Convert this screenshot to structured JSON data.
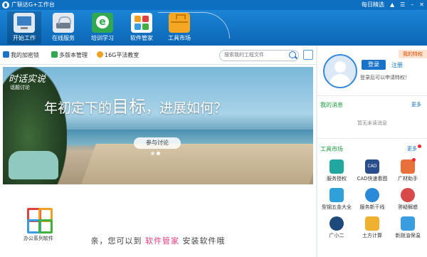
{
  "window": {
    "title": "广联达G+工作台",
    "daily_pick": "每日精选"
  },
  "nav": {
    "items": [
      {
        "label": "开始工作",
        "active": true
      },
      {
        "label": "在线服务",
        "active": false
      },
      {
        "label": "培训学习",
        "active": false
      },
      {
        "label": "软件管家",
        "active": false
      },
      {
        "label": "工具市场",
        "active": false
      }
    ]
  },
  "toolbar": {
    "encryption_lock": "我的加密锁",
    "multi_version": "多版本管理",
    "cloud_space": "16G平法教室",
    "search_placeholder": "搜索我的工程文件"
  },
  "banner": {
    "tag_line1": "时话实说",
    "tag_line2": "话题讨论",
    "headline_pre": "年初定下的",
    "headline_big": "目标",
    "headline_post": "，进展如何？",
    "join_button": "参与讨论"
  },
  "apps": {
    "office_suite": "办公系列软件"
  },
  "tip": {
    "pre": "亲，您可以到",
    "highlight": "软件管家",
    "post": "安装软件哦"
  },
  "sidebar": {
    "privilege_badge": "我的特权",
    "login_button": "登录",
    "register_link": "注册",
    "login_tip": "登录后可以申请特权！",
    "messages_title": "我的消息",
    "messages_more": "更多",
    "no_messages": "暂无未读消息",
    "tools_title": "工具市场",
    "tools_more": "更多",
    "tools": [
      {
        "label": "服务授权",
        "icon": "service-authorization-icon"
      },
      {
        "label": "CAD快速看图",
        "icon": "cad-viewer-icon"
      },
      {
        "label": "广材助手",
        "icon": "material-assistant-icon"
      },
      {
        "label": "型钢五金大全",
        "icon": "steel-hardware-icon"
      },
      {
        "label": "服务新干线",
        "icon": "service-line-icon"
      },
      {
        "label": "答疑解惑",
        "icon": "qa-icon"
      },
      {
        "label": "广小二",
        "icon": "assistant-bot-icon"
      },
      {
        "label": "土方计算",
        "icon": "earthwork-calc-icon"
      },
      {
        "label": "新刚油保温",
        "icon": "insulation-icon"
      }
    ]
  },
  "colors": {
    "primary": "#0e6fc0",
    "green_title": "#1a9a3a",
    "highlight_pink": "#e03a7a"
  }
}
